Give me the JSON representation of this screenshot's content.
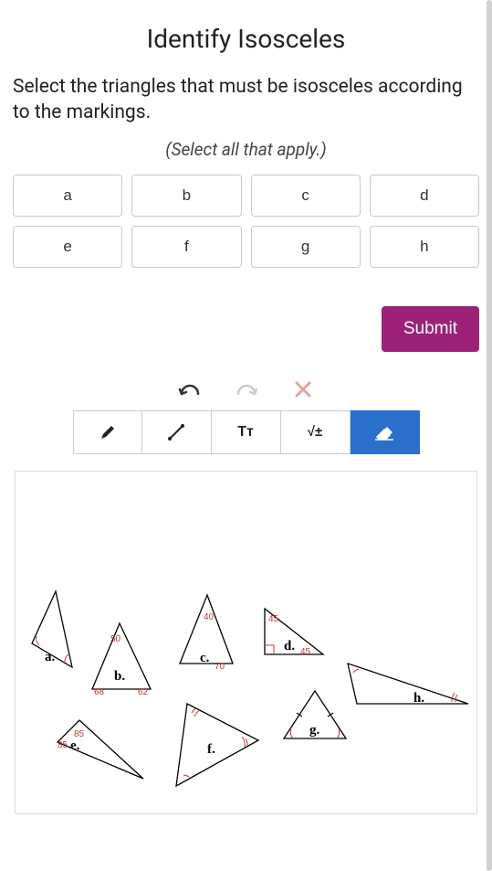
{
  "title": "Identify Isosceles",
  "instruction": "Select the triangles that must be isosceles according to the markings.",
  "hint": "(Select all that apply.)",
  "options": [
    "a",
    "b",
    "c",
    "d",
    "e",
    "f",
    "g",
    "h"
  ],
  "submit_label": "Submit",
  "toolbar": {
    "pencil": "pencil",
    "line": "line",
    "text": "Tᴛ",
    "math": "√±",
    "eraser": "eraser"
  },
  "triangles": {
    "a": {
      "label": "a."
    },
    "b": {
      "label": "b.",
      "angles": {
        "top": "50",
        "left": "68",
        "right": "62"
      }
    },
    "c": {
      "label": "c.",
      "angles": {
        "top": "40",
        "bottom": "70"
      }
    },
    "d": {
      "label": "d.",
      "angles": {
        "top": "45",
        "right": "45"
      }
    },
    "e": {
      "label": "e.",
      "angles": {
        "top": "85",
        "left": "85"
      }
    },
    "f": {
      "label": "f."
    },
    "g": {
      "label": "g."
    },
    "h": {
      "label": "h."
    }
  }
}
